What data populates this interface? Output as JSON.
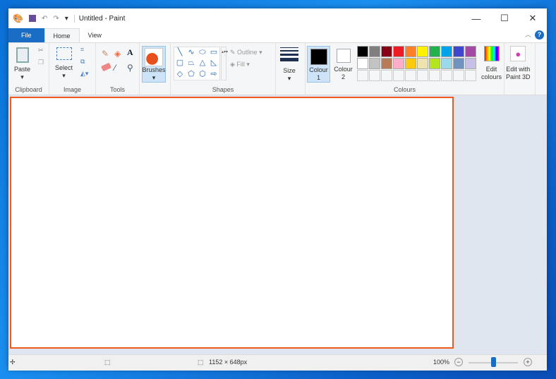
{
  "title": "Untitled - Paint",
  "tabs": {
    "file": "File",
    "home": "Home",
    "view": "View"
  },
  "clipboard": {
    "paste": "Paste",
    "label": "Clipboard"
  },
  "image": {
    "select": "Select",
    "label": "Image"
  },
  "tools": {
    "label": "Tools"
  },
  "brushes": {
    "label": "Brushes"
  },
  "shapes": {
    "outline": "Outline",
    "fill": "Fill",
    "label": "Shapes"
  },
  "size": {
    "label": "Size"
  },
  "colour1": {
    "label1": "Colour",
    "label2": "1",
    "value": "#000000"
  },
  "colour2": {
    "label1": "Colour",
    "label2": "2",
    "value": "#ffffff"
  },
  "colours": {
    "label": "Colours",
    "palette": [
      "#000000",
      "#7f7f7f",
      "#880015",
      "#ed1c24",
      "#ff7f27",
      "#fff200",
      "#22b14c",
      "#00a2e8",
      "#3f48cc",
      "#a349a4",
      "#ffffff",
      "#c3c3c3",
      "#b97a57",
      "#ffaec9",
      "#ffc90e",
      "#efe4b0",
      "#b5e61d",
      "#99d9ea",
      "#7092be",
      "#c8bfe7"
    ],
    "edit1": "Edit",
    "edit2": "colours"
  },
  "paint3d": {
    "l1": "Edit with",
    "l2": "Paint 3D"
  },
  "status": {
    "dimensions": "1152 × 648px",
    "zoom": "100%",
    "zoom_fraction": 0.5
  },
  "accent": "#f05a1e"
}
